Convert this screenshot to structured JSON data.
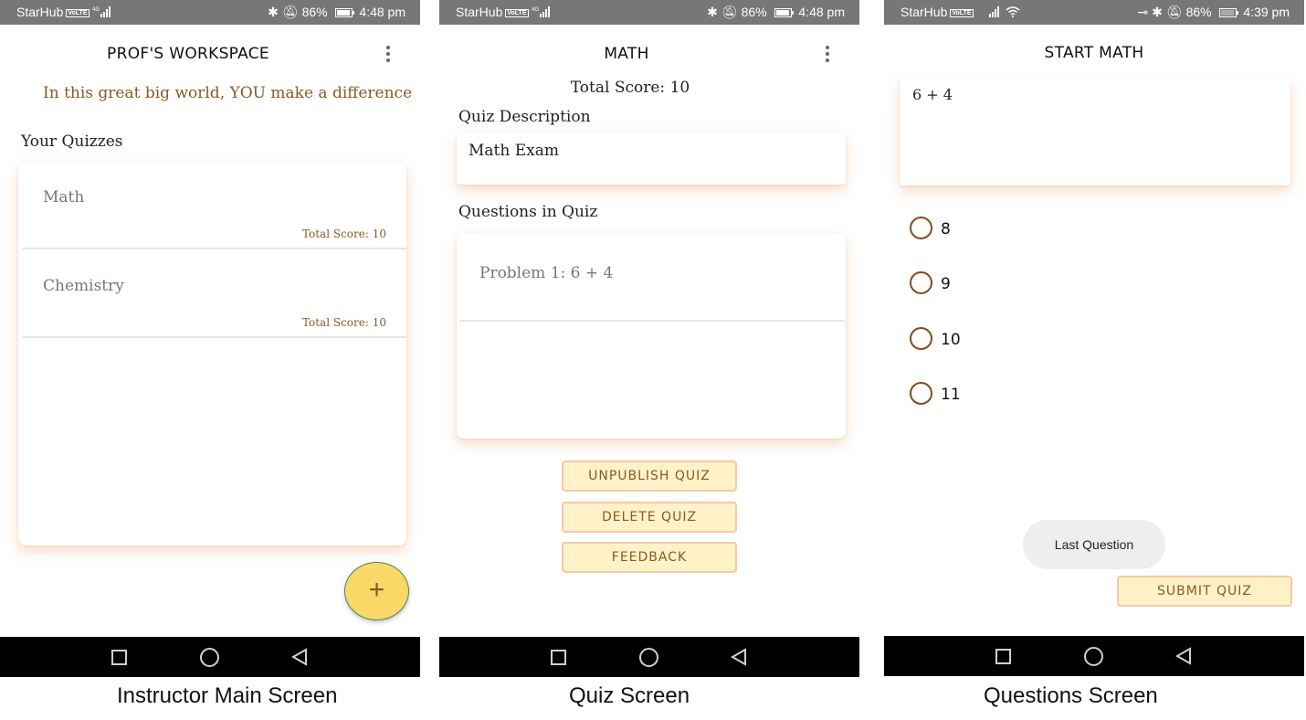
{
  "status_bars": [
    {
      "carrier": "StarHub",
      "net": "4G",
      "battery": "86%",
      "time": "4:48 pm"
    },
    {
      "carrier": "StarHub",
      "net": "4G",
      "battery": "86%",
      "time": "4:48 pm"
    },
    {
      "carrier": "StarHub",
      "net": "",
      "battery": "86%",
      "time": "4:39 pm"
    }
  ],
  "screen1": {
    "title": "PROF'S WORKSPACE",
    "motto": "In this great big world, YOU make a difference",
    "section_label": "Your Quizzes",
    "quizzes": [
      {
        "name": "Math",
        "score": "Total Score: 10"
      },
      {
        "name": "Chemistry",
        "score": "Total Score: 10"
      }
    ],
    "fab_label": "+",
    "caption": "Instructor Main Screen"
  },
  "screen2": {
    "title": "MATH",
    "total_score": "Total Score: 10",
    "description_label": "Quiz Description",
    "description_value": "Math Exam",
    "questions_label": "Questions in Quiz",
    "questions": [
      {
        "text": "Problem 1: 6 + 4"
      }
    ],
    "buttons": {
      "unpublish": "UNPUBLISH QUIZ",
      "delete": "DELETE QUIZ",
      "feedback": "FEEDBACK"
    },
    "caption": "Quiz Screen"
  },
  "screen3": {
    "title": "START MATH",
    "question": "6 + 4",
    "options": [
      "8",
      "9",
      "10",
      "11"
    ],
    "toast": "Last Question",
    "submit_label": "SUBMIT QUIZ",
    "caption": "Questions Screen"
  },
  "icons": {
    "menu": "kebab-menu-icon",
    "nav_recent": "square-icon",
    "nav_home": "circle-icon",
    "nav_back": "triangle-back-icon"
  },
  "colors": {
    "accent_text": "#8a5a22",
    "fab_fill": "#fbd867",
    "button_fill": "#fff2c8",
    "button_border": "#f5c9a6",
    "radio": "#8a4a1a",
    "status_bar": "#777777"
  }
}
